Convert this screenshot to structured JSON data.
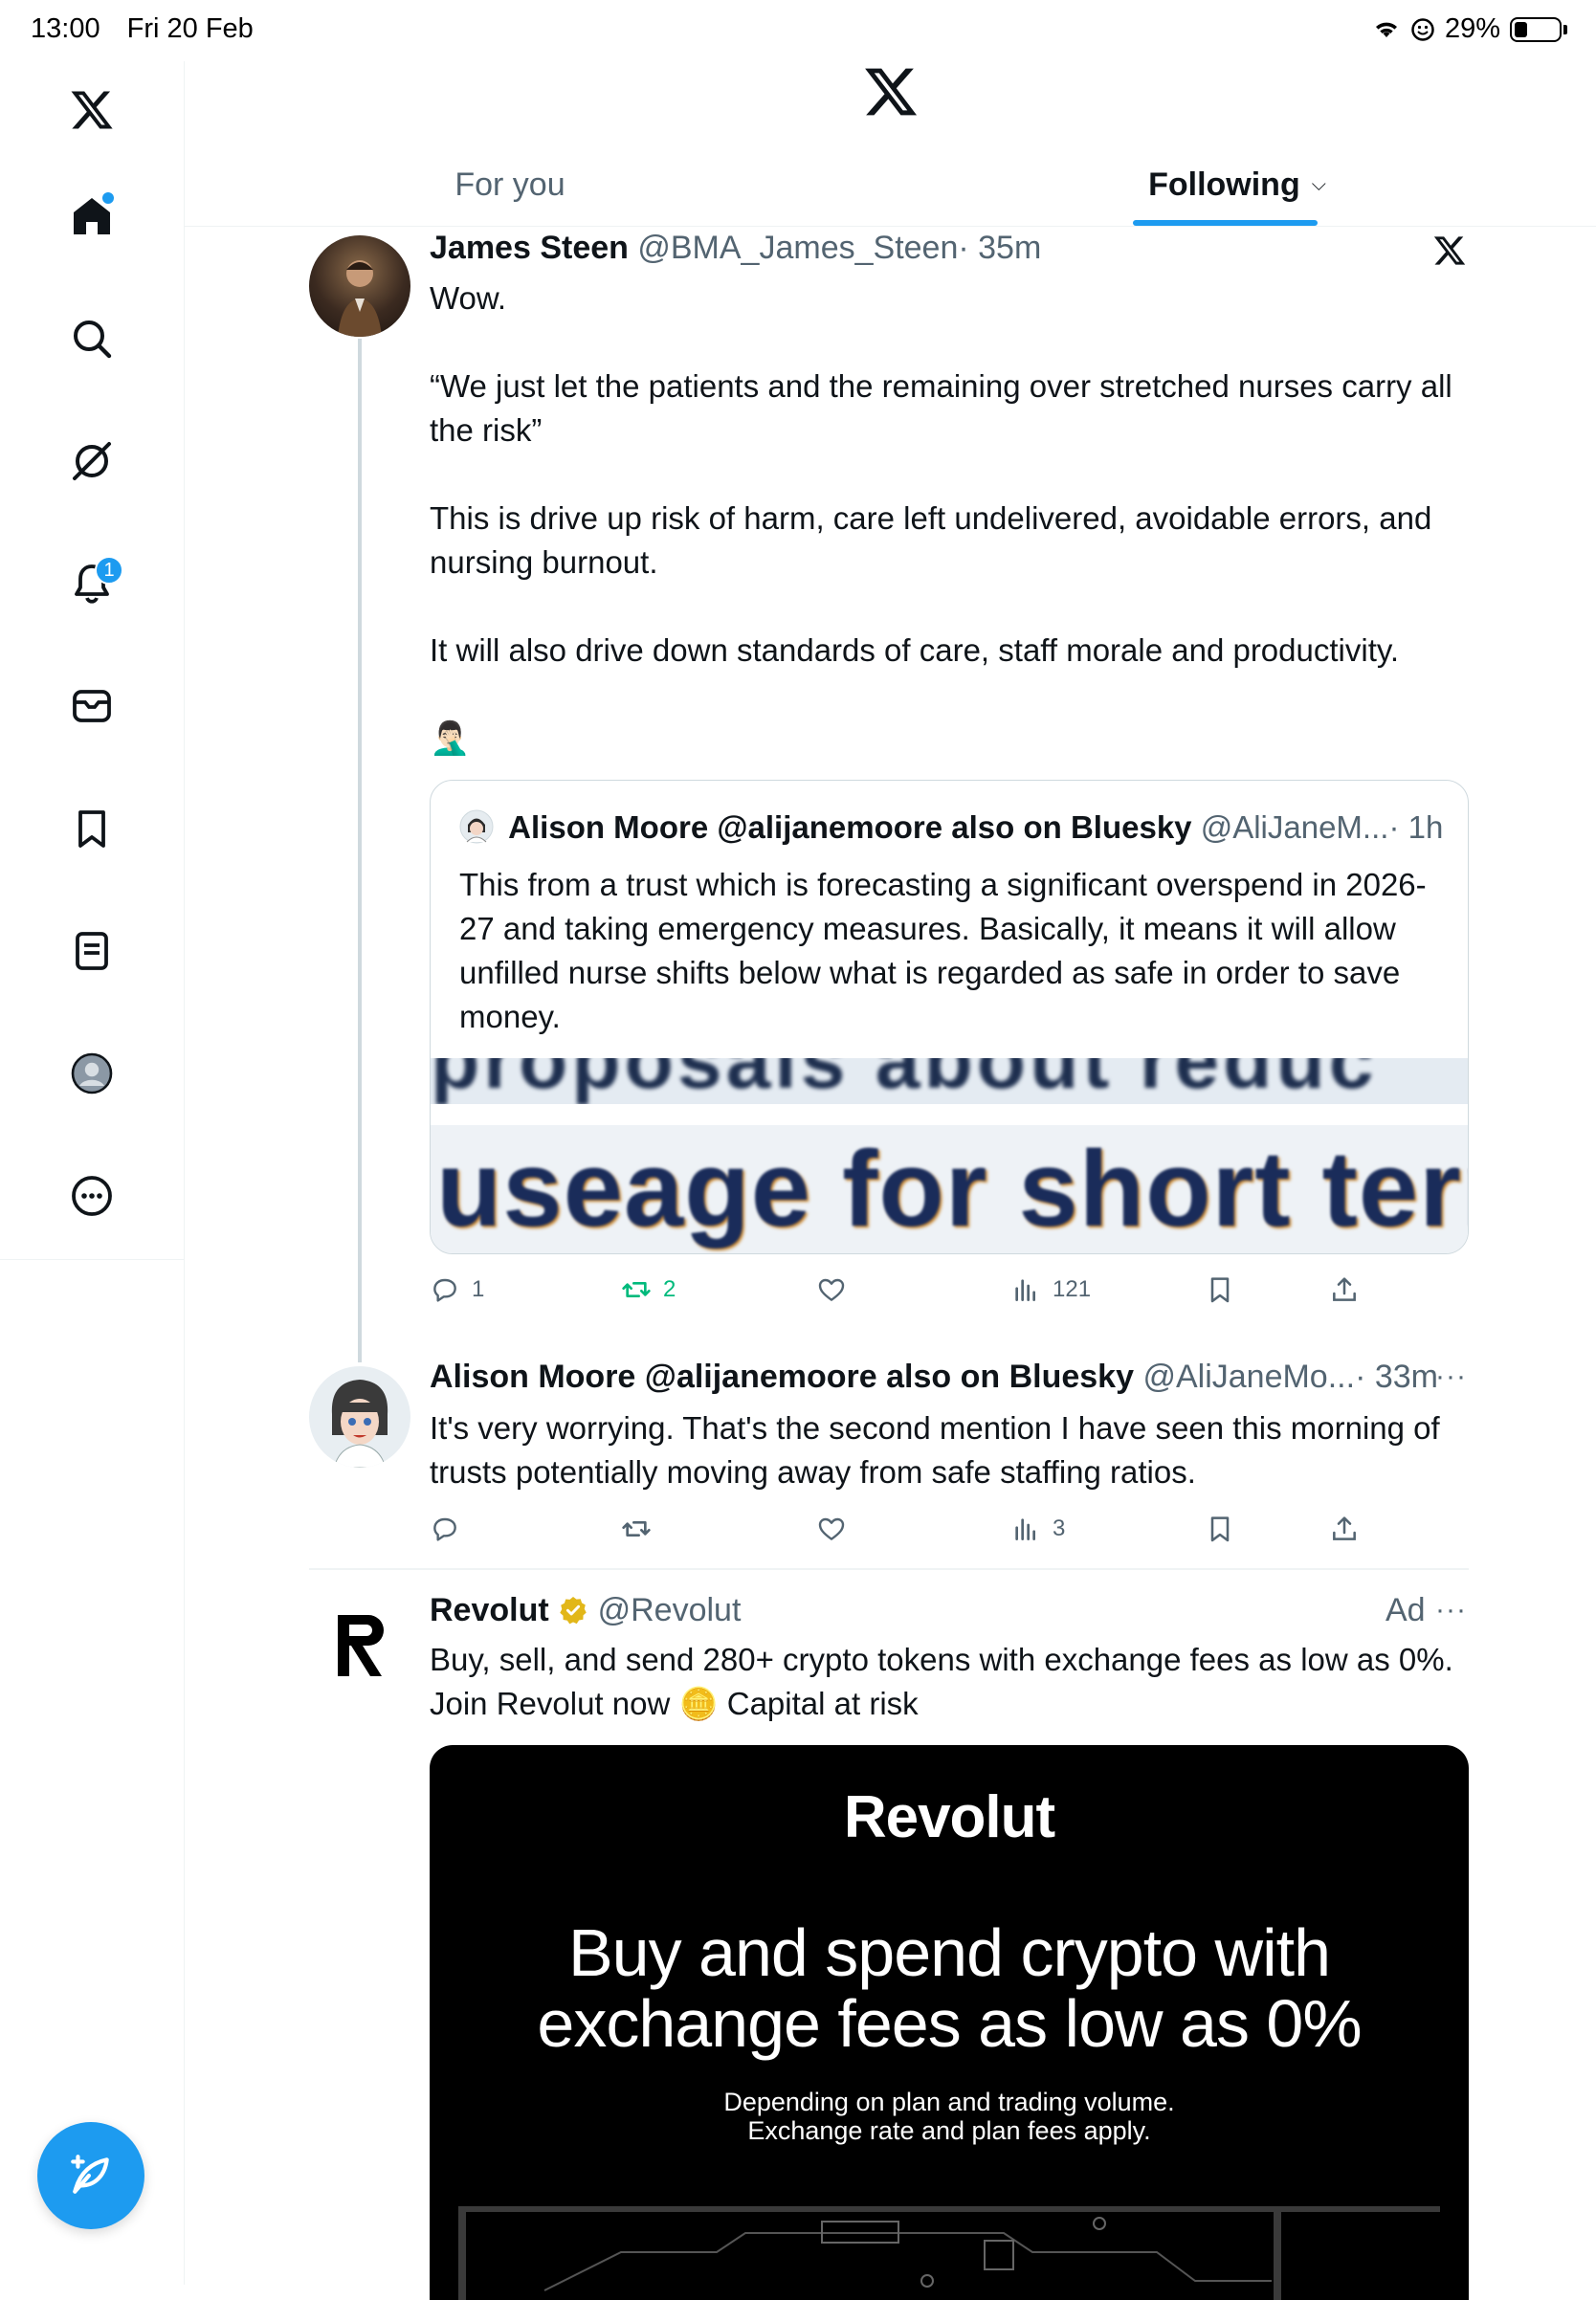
{
  "status_bar": {
    "time": "13:00",
    "date": "Fri 20 Feb",
    "battery": "29%",
    "battery_level": 0.29
  },
  "sidebar": {
    "items": [
      {
        "name": "home",
        "icon": "home-icon"
      },
      {
        "name": "search",
        "icon": "search-icon"
      },
      {
        "name": "grok",
        "icon": "grok-icon"
      },
      {
        "name": "notifications",
        "icon": "bell-icon",
        "badge": "1"
      },
      {
        "name": "messages",
        "icon": "mail-icon"
      },
      {
        "name": "bookmarks",
        "icon": "bookmark-icon"
      },
      {
        "name": "lists",
        "icon": "list-icon"
      },
      {
        "name": "profile",
        "icon": "profile-icon"
      },
      {
        "name": "more",
        "icon": "more-icon"
      }
    ]
  },
  "header": {
    "tabs": [
      {
        "label": "For you",
        "active": false
      },
      {
        "label": "Following",
        "active": true
      }
    ]
  },
  "tweets": [
    {
      "name": "James Steen",
      "handle": "@BMA_James_Steen",
      "time": "· 35m",
      "paragraphs": [
        "Wow.",
        "“We just let the patients and the remaining over stretched nurses carry all the risk”",
        "This is drive up risk of harm, care left undelivered, avoidable errors, and nursing burnout.",
        "It will also drive down standards of care, staff morale and productivity."
      ],
      "emoji": "🤦🏻‍♂️",
      "quote": {
        "name": "Alison Moore @alijanemoore also on Bluesky",
        "handle": "@AliJaneM...",
        "time": "· 1h",
        "text": "This from a trust which is forecasting a significant overspend in 2026-27 and taking emergency measures.  Basically, it means it will allow unfilled nurse shifts below what is regarded as safe in order to save money.",
        "image_text": "useage for short term",
        "image_text_top": "proposals about reduc"
      },
      "stats": {
        "replies": "1",
        "retweets": "2",
        "views": "121"
      }
    },
    {
      "name": "Alison Moore @alijanemoore also on Bluesky",
      "handle": "@AliJaneMo...",
      "time": "· 33m",
      "text": "It's very worrying. That's the second mention I have seen this morning of trusts potentially moving away from safe staffing ratios.",
      "stats": {
        "replies": "",
        "retweets": "",
        "views": "3"
      }
    },
    {
      "name": "Revolut",
      "handle": "@Revolut",
      "ad_label": "Ad",
      "text_before": "Buy, sell, and send 280+ crypto tokens with exchange fees as low as 0%. Join Revolut now",
      "text_emoji": "🪙",
      "text_after": "Capital at risk",
      "card": {
        "brand": "Revolut",
        "headline_line1": "Buy and spend crypto with",
        "headline_line2": "exchange fees as low as 0%",
        "sub_line1": "Depending on plan and trading volume.",
        "sub_line2": "Exchange rate and plan fees apply."
      }
    }
  ],
  "colors": {
    "accent": "#1d9bf0",
    "retweet_green": "#00ba7c",
    "verified_gold": "#e2b719",
    "text_secondary": "#536471"
  }
}
